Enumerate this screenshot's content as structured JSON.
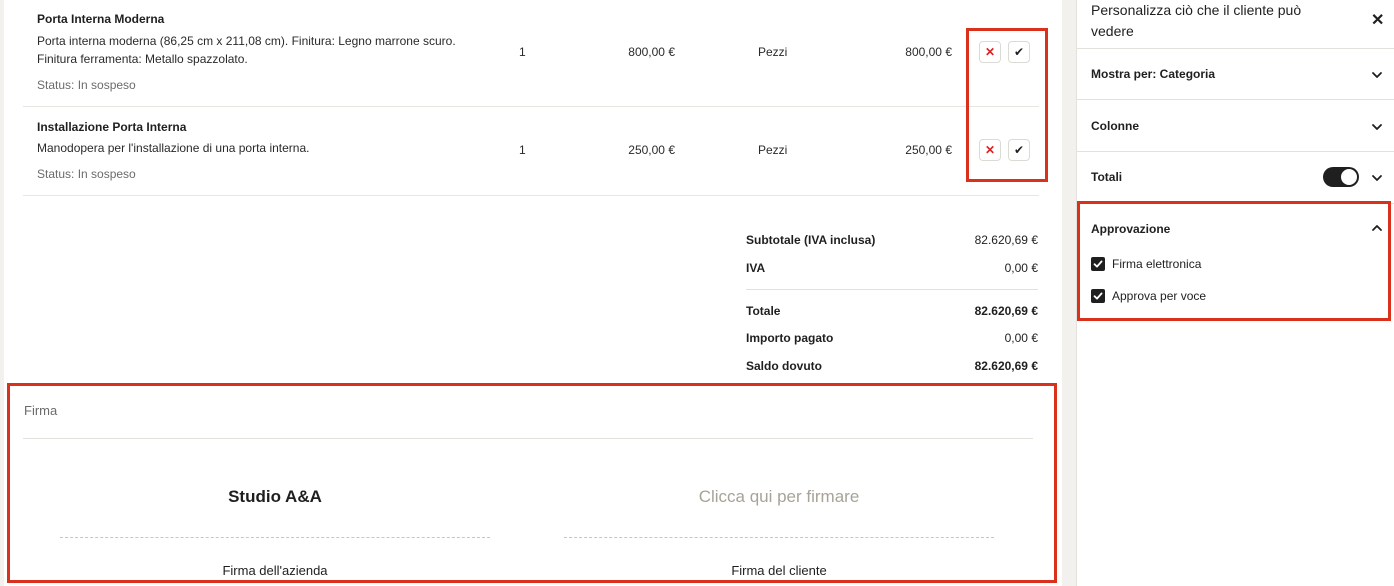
{
  "items": [
    {
      "title": "Porta Interna Moderna",
      "description": "Porta interna moderna (86,25 cm x 211,08 cm). Finitura: Legno marrone scuro. Finitura ferramenta: Metallo spazzolato.",
      "status": "Status: In sospeso",
      "quantity": "1",
      "unit_price": "800,00 €",
      "unit": "Pezzi",
      "total": "800,00 €"
    },
    {
      "title": "Installazione Porta Interna",
      "description": "Manodopera per l'installazione di una porta interna.",
      "status": "Status: In sospeso",
      "quantity": "1",
      "unit_price": "250,00 €",
      "unit": "Pezzi",
      "total": "250,00 €"
    }
  ],
  "actions": {
    "reject_icon": "close-icon",
    "approve_icon": "check-icon"
  },
  "totals": {
    "subtotal_label": "Subtotale (IVA inclusa)",
    "subtotal_value": "82.620,69 €",
    "iva_label": "IVA",
    "iva_value": "0,00 €",
    "total_label": "Totale",
    "total_value": "82.620,69 €",
    "paid_label": "Importo pagato",
    "paid_value": "0,00 €",
    "due_label": "Saldo dovuto",
    "due_value": "82.620,69 €"
  },
  "signature": {
    "section_label": "Firma",
    "company_name": "Studio A&A",
    "client_placeholder": "Clicca qui per firmare",
    "company_caption": "Firma dell'azienda",
    "client_caption": "Firma del cliente"
  },
  "panel": {
    "title": "Personalizza ciò che il cliente può vedere",
    "show_by": "Mostra per: Categoria",
    "columns": "Colonne",
    "totals": "Totali",
    "totals_toggle_on": true,
    "approval": "Approvazione",
    "options": [
      {
        "label": "Firma elettronica",
        "checked": true
      },
      {
        "label": "Approva per voce",
        "checked": true
      }
    ]
  },
  "colors": {
    "highlight": "#d9311b",
    "reject": "#dd2222",
    "placeholder": "#a7a397"
  }
}
